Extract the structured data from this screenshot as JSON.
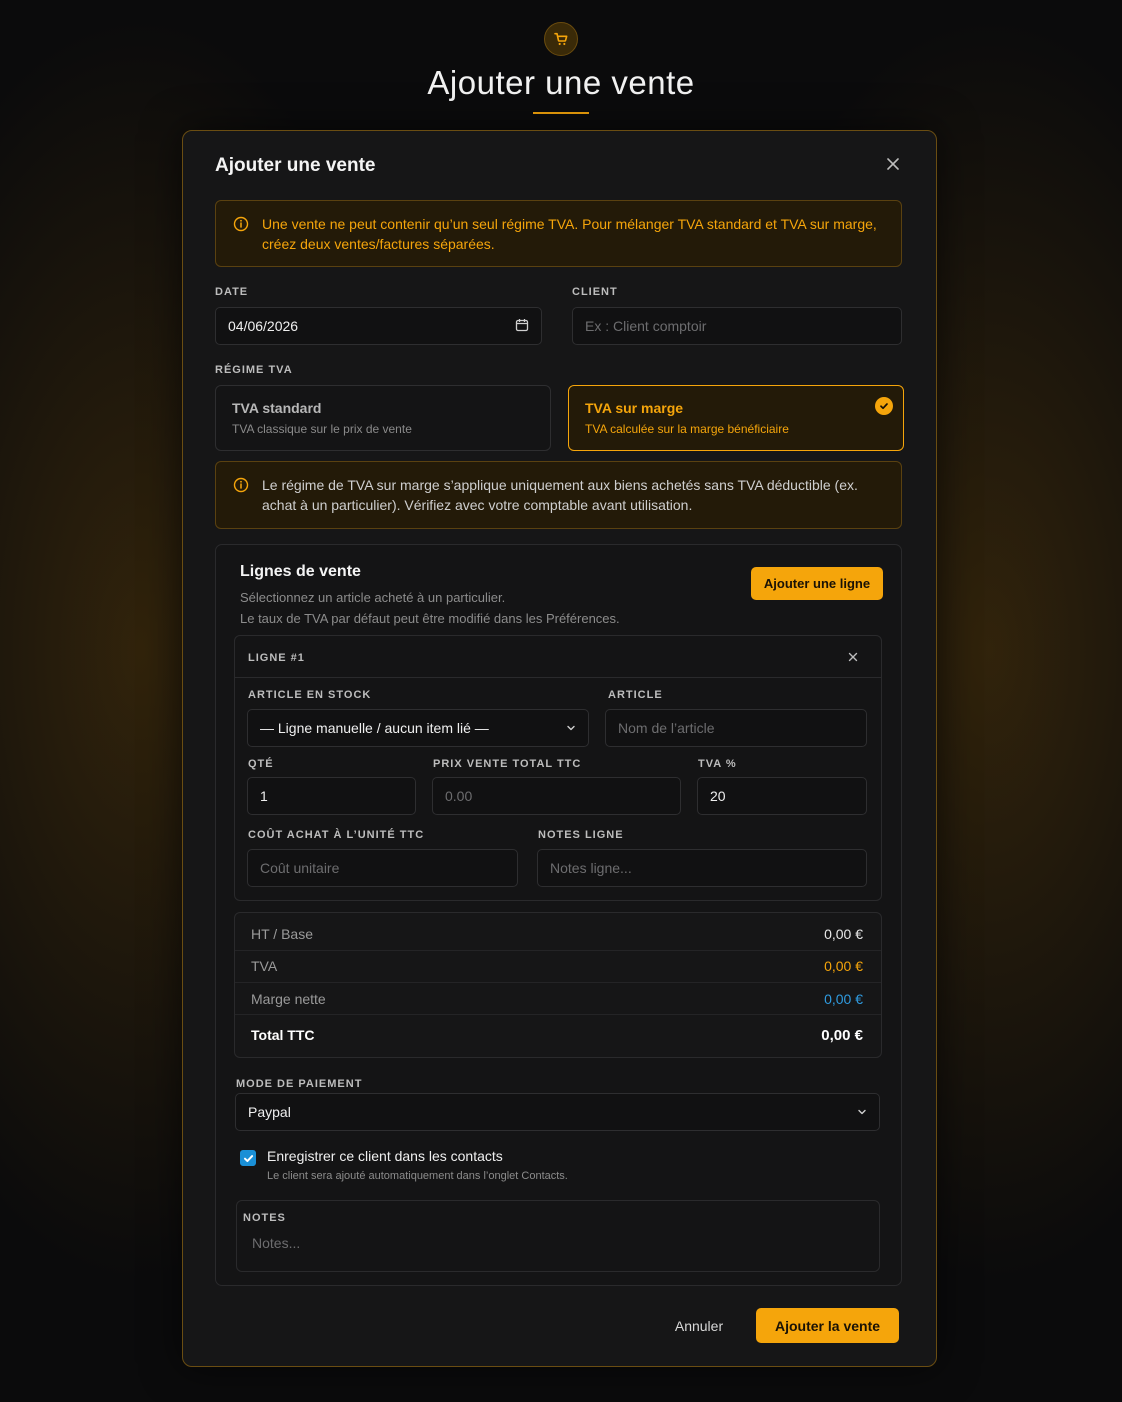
{
  "header": {
    "title": "Ajouter une vente",
    "icon": "cart-icon"
  },
  "modal": {
    "title": "Ajouter une vente",
    "close_icon": "close-icon",
    "alert_single_regime": "Une vente ne peut contenir qu’un seul régime TVA. Pour mélanger TVA standard et TVA sur marge, créez deux ventes/factures séparées.",
    "date": {
      "label": "DATE",
      "value": "04/06/2026"
    },
    "client": {
      "label": "CLIENT",
      "placeholder": "Ex : Client comptoir"
    },
    "regime_label": "RÉGIME TVA",
    "regimes": [
      {
        "title": "TVA standard",
        "subtitle": "TVA classique sur le prix de vente",
        "selected": false
      },
      {
        "title": "TVA sur marge",
        "subtitle": "TVA calculée sur la marge bénéficiaire",
        "selected": true
      }
    ],
    "alert_margin": "Le régime de TVA sur marge s’applique uniquement aux biens achetés sans TVA déductible (ex. achat à un particulier). Vérifiez avec votre comptable avant utilisation.",
    "lines": {
      "title": "Lignes de vente",
      "subtitle_1": "Sélectionnez un article acheté à un particulier.",
      "subtitle_2": "Le taux de TVA par défaut peut être modifié dans les Préférences.",
      "add_line_label": "Ajouter une ligne",
      "line": {
        "header": "LIGNE #1",
        "stock_label": "ARTICLE EN STOCK",
        "stock_value": "— Ligne manuelle / aucun item lié —",
        "article_label": "ARTICLE",
        "article_placeholder": "Nom de l’article",
        "qty_label": "QTÉ",
        "qty_value": "1",
        "price_label": "PRIX VENTE TOTAL TTC",
        "price_placeholder": "0.00",
        "vat_label": "TVA %",
        "vat_value": "20",
        "cost_label": "COÛT ACHAT À L’UNITÉ TTC",
        "cost_placeholder": "Coût unitaire",
        "notes_label": "NOTES LIGNE",
        "notes_placeholder": "Notes ligne..."
      },
      "totals": [
        {
          "label": "HT / Base",
          "value": "0,00 €",
          "color": "#e8e8e8"
        },
        {
          "label": "TVA",
          "value": "0,00 €",
          "color": "#f5a50b"
        },
        {
          "label": "Marge nette",
          "value": "0,00 €",
          "color": "#2f9be0"
        },
        {
          "label": "Total TTC",
          "value": "0,00 €",
          "color": "#ffffff"
        }
      ],
      "payment_label": "MODE DE PAIEMENT",
      "payment_value": "Paypal",
      "save_contact_label": "Enregistrer ce client dans les contacts",
      "save_contact_hint": "Le client sera ajouté automatiquement dans l’onglet Contacts.",
      "save_contact_checked": true,
      "notes_label": "NOTES",
      "notes_placeholder": "Notes..."
    },
    "cancel_label": "Annuler",
    "submit_label": "Ajouter la vente"
  },
  "colors": {
    "accent": "#f5a50b",
    "link_blue": "#2f9be0",
    "checkbox": "#1a8fd6"
  }
}
